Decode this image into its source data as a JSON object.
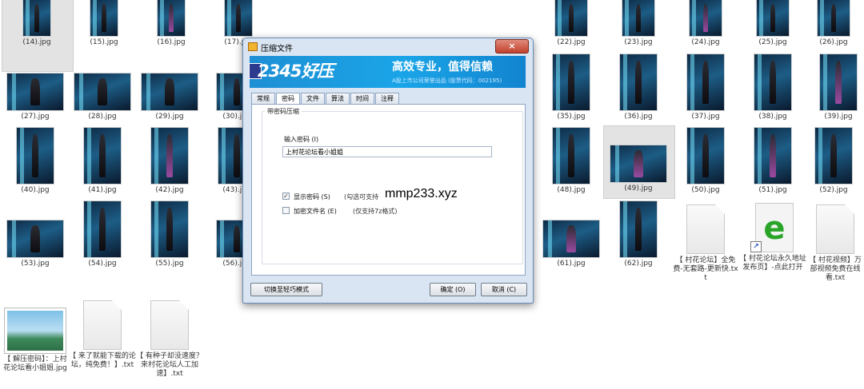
{
  "files": {
    "r1": [
      "(14).jpg",
      "(15).jpg",
      "(16).jpg",
      "(17).jpg",
      "(22).jpg",
      "(23).jpg",
      "(24).jpg",
      "(25).jpg",
      "(26).jpg"
    ],
    "r2": [
      "(27).jpg",
      "(28).jpg",
      "(29).jpg",
      "(30).jpg",
      "(35).jpg",
      "(36).jpg",
      "(37).jpg",
      "(38).jpg",
      "(39).jpg"
    ],
    "r3": [
      "(40).jpg",
      "(41).jpg",
      "(42).jpg",
      "(43).jpg",
      "(48).jpg",
      "(49).jpg",
      "(50).jpg",
      "(51).jpg",
      "(52).jpg"
    ],
    "r4": [
      "(53).jpg",
      "(54).jpg",
      "(55).jpg",
      "(56).jpg",
      "(61).jpg",
      "(62).jpg"
    ],
    "txt_a": "【 村花论坛】全免费-无套路-更新快.txt",
    "shortcut": "【 村花论坛永久地址发布页】-点此打开",
    "txt_b": "【 村花视频】万部视频免费在线看.txt",
    "img_file": "【 解压密码】：上村花论坛看小姐姐.jpg",
    "txt_c": "【 来了就能下载的论坛，纯免费！】.txt",
    "txt_d": "【 有种子却没速度？来村花论坛人工加速】.txt"
  },
  "dialog": {
    "title": "压缩文件",
    "close": "×",
    "brand": "2345好压",
    "slogan": "高效专业，值得信赖",
    "subline": "A股上市公司荣誉出品 (股票代码：002195)",
    "tabs": [
      "常规",
      "密码",
      "文件",
      "算法",
      "时间",
      "注释"
    ],
    "group_title": "带密码压缩",
    "password_label": "输入密码 (I)",
    "password_value": "上村花论坛看小姐姐",
    "show_password": "显示密码 (S)",
    "show_password_note": "(勾选可支持",
    "encrypt_names": "加密文件名 (E)",
    "encrypt_names_note": "(仅支持7z格式)",
    "switch_mode": "切换至轻巧模式",
    "ok": "确定 (O)",
    "cancel": "取消 (C)"
  },
  "overlay_text": "mmp233.xyz"
}
